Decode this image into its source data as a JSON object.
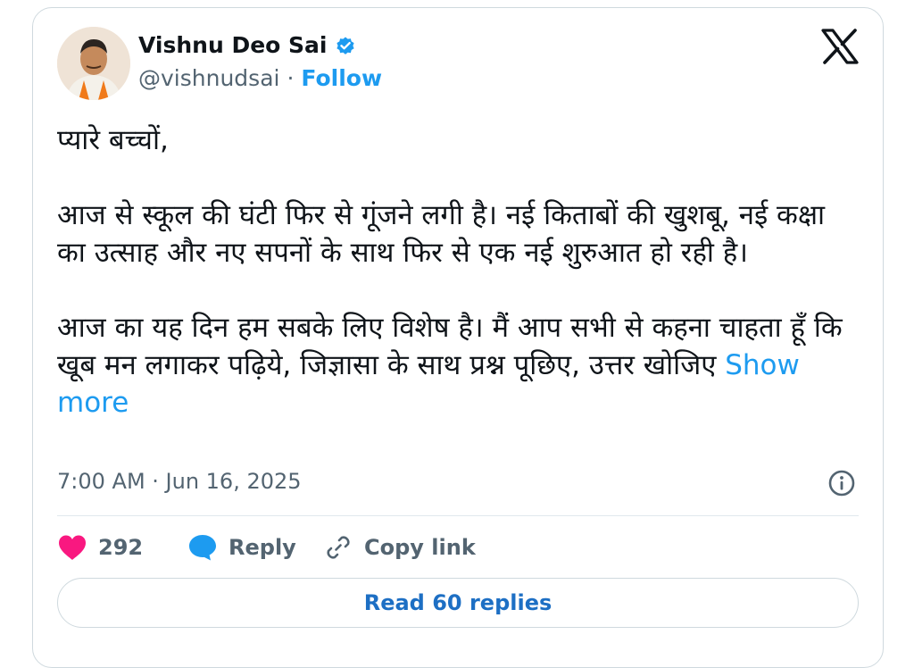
{
  "author": {
    "name": "Vishnu Deo Sai",
    "handle": "@vishnudsai",
    "separator": "·",
    "follow_label": "Follow"
  },
  "tweet": {
    "text": "प्यारे बच्चों,\n\nआज से स्कूल की घंटी फिर से गूंजने लगी है। नई किताबों की खुशबू, नई कक्षा का उत्साह और नए सपनों के साथ फिर से एक नई शुरुआत हो रही है।\n\nआज का यह दिन हम सबके लिए विशेष है। मैं आप सभी से कहना चाहता हूँ कि खूब मन लगाकर पढ़िये, जिज्ञासा के साथ प्रश्न पूछिए, उत्तर खोजिए ",
    "show_more_label": "Show more",
    "timestamp": "7:00 AM · Jun 16, 2025"
  },
  "actions": {
    "like_count": "292",
    "reply_label": "Reply",
    "copy_link_label": "Copy link"
  },
  "read_replies_label": "Read 60 replies",
  "icons": {
    "verified": "verified-badge-icon",
    "x_logo": "x-logo-icon",
    "info": "info-icon",
    "like": "heart-icon",
    "reply": "speech-bubble-icon",
    "copy_link": "link-icon"
  },
  "colors": {
    "accent": "#1d9bf0",
    "like": "#f91880",
    "muted": "#536471",
    "text": "#0f1419",
    "border": "#cfd9de"
  }
}
